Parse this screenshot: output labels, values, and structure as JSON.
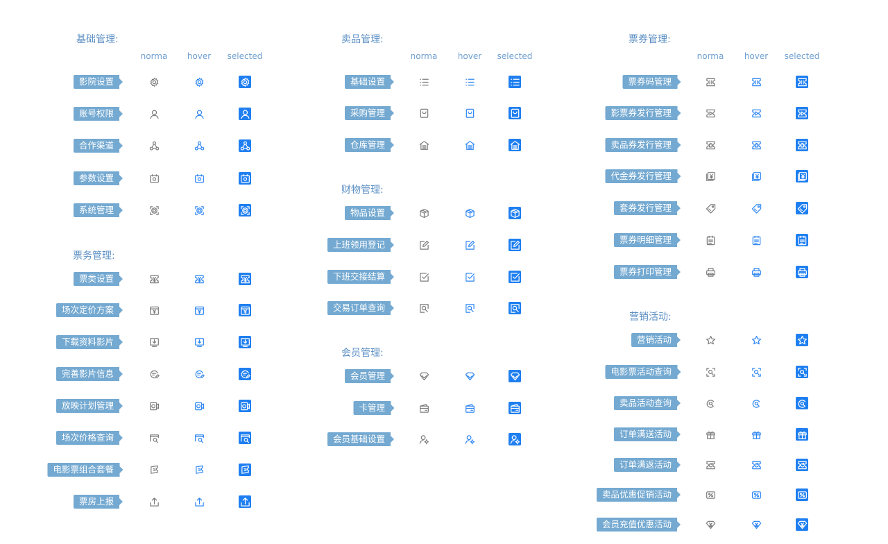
{
  "colors": {
    "accent": "#1f7ff0",
    "hover": "#2e86f3",
    "normal": "#7c7c7c",
    "tag": "#74a9d1",
    "title": "#5b8fc4"
  },
  "state_headers": [
    "norma",
    "hover",
    "selected"
  ],
  "columns": [
    {
      "sections": [
        {
          "title": "基础管理:",
          "show_headers": true,
          "items": [
            {
              "label": "影院设置",
              "icon": "gear-icon"
            },
            {
              "label": "账号权限",
              "icon": "user-icon"
            },
            {
              "label": "合作渠道",
              "icon": "share-nodes-icon"
            },
            {
              "label": "参数设置",
              "icon": "settings-panel-icon"
            },
            {
              "label": "系统管理",
              "icon": "system-gear-icon"
            }
          ]
        },
        {
          "title": "票务管理:",
          "show_headers": false,
          "items": [
            {
              "label": "票类设置",
              "icon": "ticket-yen-icon"
            },
            {
              "label": "场次定价方案",
              "icon": "price-plan-icon"
            },
            {
              "label": "下载资料影片",
              "icon": "download-film-icon"
            },
            {
              "label": "完善影片信息",
              "icon": "edit-film-icon"
            },
            {
              "label": "放映计划管理",
              "icon": "projector-icon"
            },
            {
              "label": "场次价格查询",
              "icon": "price-search-icon"
            },
            {
              "label": "电影票组合套餐",
              "icon": "combo-ticket-icon"
            },
            {
              "label": "票房上报",
              "icon": "upload-icon"
            }
          ]
        }
      ]
    },
    {
      "sections": [
        {
          "title": "卖品管理:",
          "show_headers": true,
          "items": [
            {
              "label": "基础设置",
              "icon": "list-icon"
            },
            {
              "label": "采购管理",
              "icon": "shopping-bag-icon"
            },
            {
              "label": "仓库管理",
              "icon": "warehouse-icon"
            }
          ]
        },
        {
          "title": "财物管理:",
          "show_headers": false,
          "items": [
            {
              "label": "物品设置",
              "icon": "box-icon"
            },
            {
              "label": "上班领用登记",
              "icon": "edit-square-icon"
            },
            {
              "label": "下班交接结算",
              "icon": "check-square-icon"
            },
            {
              "label": "交易订单查询",
              "icon": "search-square-icon"
            }
          ]
        },
        {
          "title": "会员管理:",
          "show_headers": false,
          "items": [
            {
              "label": "会员管理",
              "icon": "diamond-icon"
            },
            {
              "label": "卡管理",
              "icon": "wallet-card-icon"
            },
            {
              "label": "会员基础设置",
              "icon": "member-settings-icon"
            }
          ]
        }
      ]
    },
    {
      "sections": [
        {
          "title": "票券管理:",
          "show_headers": true,
          "items": [
            {
              "label": "票券码管理",
              "icon": "coupon-code-icon"
            },
            {
              "label": "影票券发行管理",
              "icon": "film-coupon-icon"
            },
            {
              "label": "卖品券发行管理",
              "icon": "goods-coupon-icon"
            },
            {
              "label": "代金券发行管理",
              "icon": "voucher-icon"
            },
            {
              "label": "套券发行管理",
              "icon": "tag-icon"
            },
            {
              "label": "票券明细管理",
              "icon": "clipboard-icon"
            },
            {
              "label": "票券打印管理",
              "icon": "printer-icon"
            }
          ]
        },
        {
          "title": "营销活动:",
          "show_headers": false,
          "items": [
            {
              "label": "营销活动",
              "icon": "star-icon"
            },
            {
              "label": "电影票活动查询",
              "icon": "film-search-icon"
            },
            {
              "label": "卖品活动查询",
              "icon": "goods-search-icon"
            },
            {
              "label": "订单满送活动",
              "icon": "gift-icon"
            },
            {
              "label": "订单满返活动",
              "icon": "refund-ticket-icon"
            },
            {
              "label": "卖品优惠促销活动",
              "icon": "discount-icon"
            },
            {
              "label": "会员充值优惠活动",
              "icon": "member-discount-icon"
            }
          ]
        }
      ]
    }
  ]
}
